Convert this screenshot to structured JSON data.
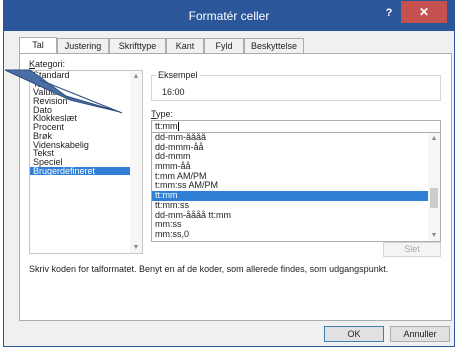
{
  "window": {
    "title": "Formatér celler",
    "help_label": "?",
    "close_label": "✕"
  },
  "tabs": [
    {
      "label": "Tal"
    },
    {
      "label": "Justering"
    },
    {
      "label": "Skrifttype"
    },
    {
      "label": "Kant"
    },
    {
      "label": "Fyld"
    },
    {
      "label": "Beskyttelse"
    }
  ],
  "category": {
    "label_mnemonic": "K",
    "label_rest": "ategori:",
    "items": [
      "Standard",
      "Tal",
      "Valuta",
      "Revision",
      "Dato",
      "Klokkeslæt",
      "Procent",
      "Brøk",
      "Videnskabelig",
      "Tekst",
      "Speciel",
      "Brugerdefineret"
    ],
    "selected": "Brugerdefineret"
  },
  "example": {
    "legend": "Eksempel",
    "value": "16:00"
  },
  "type": {
    "label_mnemonic": "T",
    "label_rest": "ype:",
    "value": "tt:mm"
  },
  "formats": {
    "items": [
      "dd-mm-åååå",
      "dd-mmm-åå",
      "dd-mmm",
      "mmm-åå",
      "t:mm AM/PM",
      "t:mm:ss AM/PM",
      "tt:mm",
      "tt:mm:ss",
      "dd-mm-åååå tt:mm",
      "mm:ss",
      "mm:ss,0"
    ],
    "selected": "tt:mm"
  },
  "delete_label": "Slet",
  "description": "Skriv koden for talformatet. Benyt en af de koder, som allerede findes, som udgangspunkt.",
  "buttons": {
    "ok": "OK",
    "cancel": "Annuller"
  },
  "colors": {
    "titlebar": "#2b579a",
    "selection": "#2f7fd6",
    "close": "#c75050"
  }
}
